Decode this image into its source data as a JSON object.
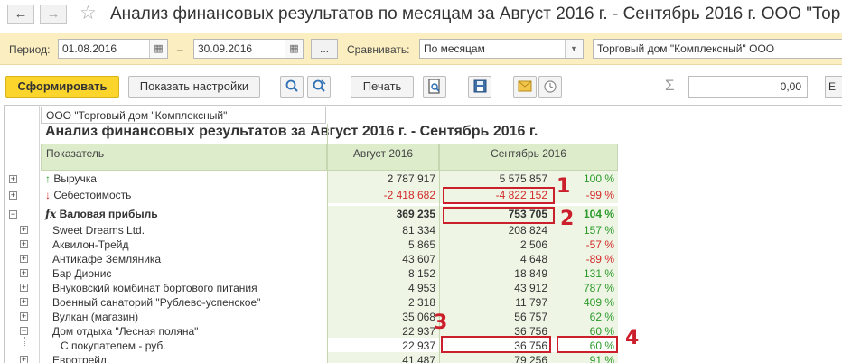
{
  "window": {
    "title": "Анализ финансовых результатов по месяцам за Август 2016 г. - Сентябрь 2016 г. ООО \"Тор"
  },
  "filters": {
    "period_label": "Период:",
    "date_from": "01.08.2016",
    "dash": "–",
    "date_to": "30.09.2016",
    "more_label": "...",
    "compare_label": "Сравнивать:",
    "compare_value": "По месяцам",
    "organization": "Торговый дом \"Комплексный\" ООО"
  },
  "toolbar": {
    "generate_label": "Сформировать",
    "settings_label": "Показать настройки",
    "print_label": "Печать",
    "sum_value": "0,00",
    "edge_label": "Е"
  },
  "report": {
    "company": "ООО \"Торговый дом \"Комплексный\"",
    "title": "Анализ финансовых результатов за Август 2016 г. - Сентябрь 2016 г.",
    "columns": [
      "Показатель",
      "Август 2016",
      "Сентябрь 2016"
    ],
    "rows": [
      {
        "name": "Выручка",
        "v1": "2 787 917",
        "v2": "5 575 857",
        "pct": "100 %"
      },
      {
        "name": "Себестоимость",
        "v1": "-2 418 682",
        "v2": "-4 822 152",
        "pct": "-99 %"
      },
      {
        "name": "Валовая прибыль",
        "v1": "369 235",
        "v2": "753 705",
        "pct": "104 %"
      },
      {
        "name": "Sweet Dreams Ltd.",
        "v1": "81 334",
        "v2": "208 824",
        "pct": "157 %"
      },
      {
        "name": "Аквилон-Трейд",
        "v1": "5 865",
        "v2": "2 506",
        "pct": "-57 %"
      },
      {
        "name": "Антикафе Земляника",
        "v1": "43 607",
        "v2": "4 648",
        "pct": "-89 %"
      },
      {
        "name": "Бар Дионис",
        "v1": "8 152",
        "v2": "18 849",
        "pct": "131 %"
      },
      {
        "name": "Внуковский комбинат бортового питания",
        "v1": "4 953",
        "v2": "43 912",
        "pct": "787 %"
      },
      {
        "name": "Военный санаторий \"Рублево-успенское\"",
        "v1": "2 318",
        "v2": "11 797",
        "pct": "409 %"
      },
      {
        "name": "Вулкан (магазин)",
        "v1": "35 068",
        "v2": "56 757",
        "pct": "62 %"
      },
      {
        "name": "Дом отдыха \"Лесная поляна\"",
        "v1": "22 937",
        "v2": "36 756",
        "pct": "60 %"
      },
      {
        "name": "С покупателем - руб.",
        "v1": "22 937",
        "v2": "36 756",
        "pct": "60 %"
      },
      {
        "name": "Евротрейд",
        "v1": "41 487",
        "v2": "79 256",
        "pct": "91 %"
      }
    ]
  },
  "markers": [
    "1",
    "2",
    "3",
    "4"
  ],
  "colors": {
    "accent": "#fbd52c",
    "filter_bar": "#fbeec0",
    "header": "#ddeccb",
    "negative": "#d42a2a",
    "positive": "#2a9a2a",
    "marker": "#cc1f2c"
  }
}
